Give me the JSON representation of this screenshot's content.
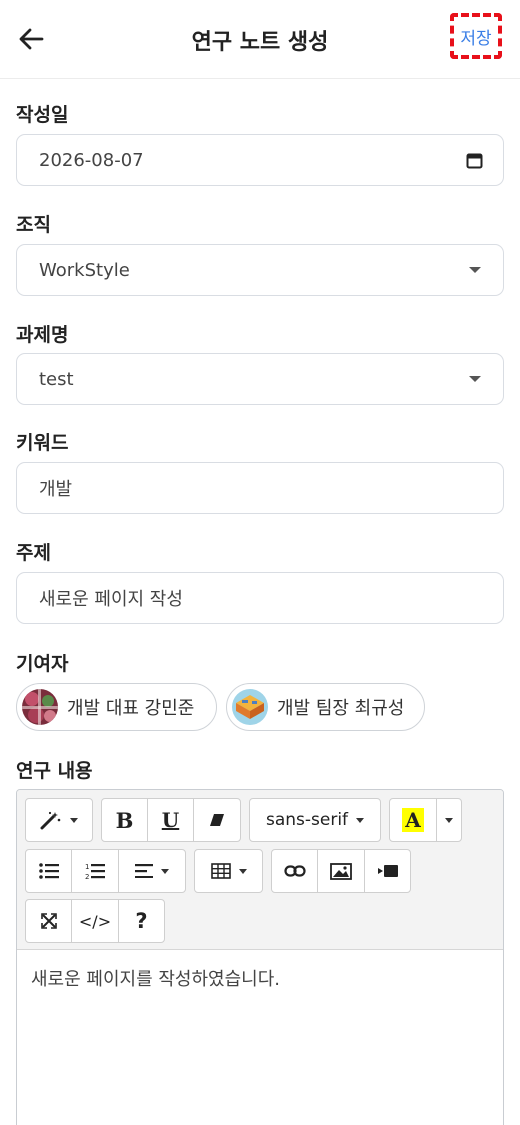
{
  "header": {
    "title": "연구 노트 생성",
    "save_label": "저장",
    "back_icon": "arrow-left-icon"
  },
  "form": {
    "date": {
      "label": "작성일",
      "value": "2026-08-07"
    },
    "org": {
      "label": "조직",
      "value": "WorkStyle"
    },
    "project": {
      "label": "과제명",
      "value": "test"
    },
    "keyword": {
      "label": "키워드",
      "value": "개발"
    },
    "subject": {
      "label": "주제",
      "value": "새로운 페이지 작성"
    },
    "contributors": {
      "label": "기여자",
      "items": [
        {
          "name": "개발 대표 강민준"
        },
        {
          "name": "개발 팀장 최규성"
        }
      ]
    },
    "content": {
      "label": "연구 내용",
      "font_name": "sans-serif",
      "body": "새로운 페이지를 작성하였습니다."
    }
  },
  "toolbar": {
    "bold": "B",
    "underline": "U",
    "highlight": "A",
    "help": "?",
    "code": "</>",
    "highlight_color": "#ffff00"
  },
  "colors": {
    "accent": "#3a7ee6",
    "save_outline": "#e8101a"
  }
}
